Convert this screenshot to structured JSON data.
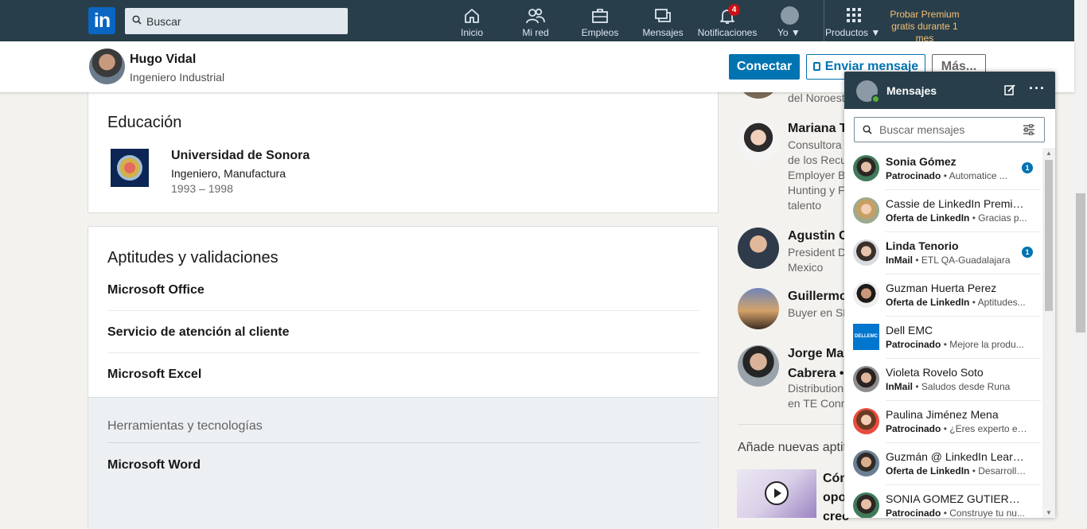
{
  "nav": {
    "logo": "in",
    "search_placeholder": "Buscar",
    "items": [
      {
        "label": "Inicio"
      },
      {
        "label": "Mi red"
      },
      {
        "label": "Empleos"
      },
      {
        "label": "Mensajes"
      },
      {
        "label": "Notificaciones",
        "badge": "4"
      },
      {
        "label": "Yo"
      },
      {
        "label": "Productos"
      }
    ],
    "premium": "Probar Premium gratis durante 1 mes"
  },
  "profile_header": {
    "name": "Hugo Vidal",
    "headline": "Ingeniero Industrial",
    "connect": "Conectar",
    "send_message": "Enviar mensaje",
    "more": "Más..."
  },
  "education": {
    "title": "Educación",
    "school": "Universidad de Sonora",
    "degree": "Ingeniero, Manufactura",
    "years": "1993 – 1998"
  },
  "skills": {
    "title": "Aptitudes y validaciones",
    "items": [
      "Microsoft Office",
      "Servicio de atención al cliente",
      "Microsoft Excel"
    ],
    "tools_title": "Herramientas y tecnologías",
    "tools_item": "Microsoft Word"
  },
  "rail": {
    "top_text": "del Noroest",
    "people": [
      {
        "name": "Mariana T",
        "lines": [
          "Consultora",
          "de los Recu",
          "Employer B",
          "Hunting y F",
          "talento"
        ]
      },
      {
        "name": "Agustin C",
        "lines": [
          "President D",
          "Mexico"
        ]
      },
      {
        "name": "Guillermo",
        "lines": [
          "Buyer en SM"
        ]
      },
      {
        "name": "Jorge Mar",
        "name2": "Cabrera •",
        "lines": [
          "Distribution",
          "en TE Conn"
        ]
      }
    ],
    "add_skills": "Añade nuevas aptit",
    "video_lines": [
      "Cóm",
      "opo",
      "crec"
    ]
  },
  "messaging": {
    "title": "Mensajes",
    "search_placeholder": "Buscar mensajes",
    "conversations": [
      {
        "name": "Sonia Gómez",
        "tag": "Patrocinado",
        "preview": "Automatice ...",
        "unread": "1"
      },
      {
        "name": "Cassie de LinkedIn Premium",
        "tag": "Oferta de LinkedIn",
        "preview": "Gracias p..."
      },
      {
        "name": "Linda Tenorio",
        "tag": "InMail",
        "preview": "ETL QA-Guadalajara",
        "unread": "1"
      },
      {
        "name": "Guzman Huerta Perez",
        "tag": "Oferta de LinkedIn",
        "preview": "Aptitudes..."
      },
      {
        "name": "Dell EMC",
        "tag": "Patrocinado",
        "preview": "Mejore la produ..."
      },
      {
        "name": "Violeta Rovelo Soto",
        "tag": "InMail",
        "preview": "Saludos desde Runa"
      },
      {
        "name": "Paulina Jiménez Mena",
        "tag": "Patrocinado",
        "preview": "¿Eres experto en..."
      },
      {
        "name": "Guzmán @ LinkedIn Learni...",
        "tag": "Oferta de LinkedIn",
        "preview": "Desarrolla..."
      },
      {
        "name": "SONIA GOMEZ GUTIERREZ",
        "tag": "Patrocinado",
        "preview": "Construye tu nu..."
      }
    ]
  },
  "colors": {
    "nav_bg": "#283e4a",
    "brand_blue": "#0073b1",
    "premium_gold": "#f5c075",
    "badge_red": "#cc1016"
  }
}
